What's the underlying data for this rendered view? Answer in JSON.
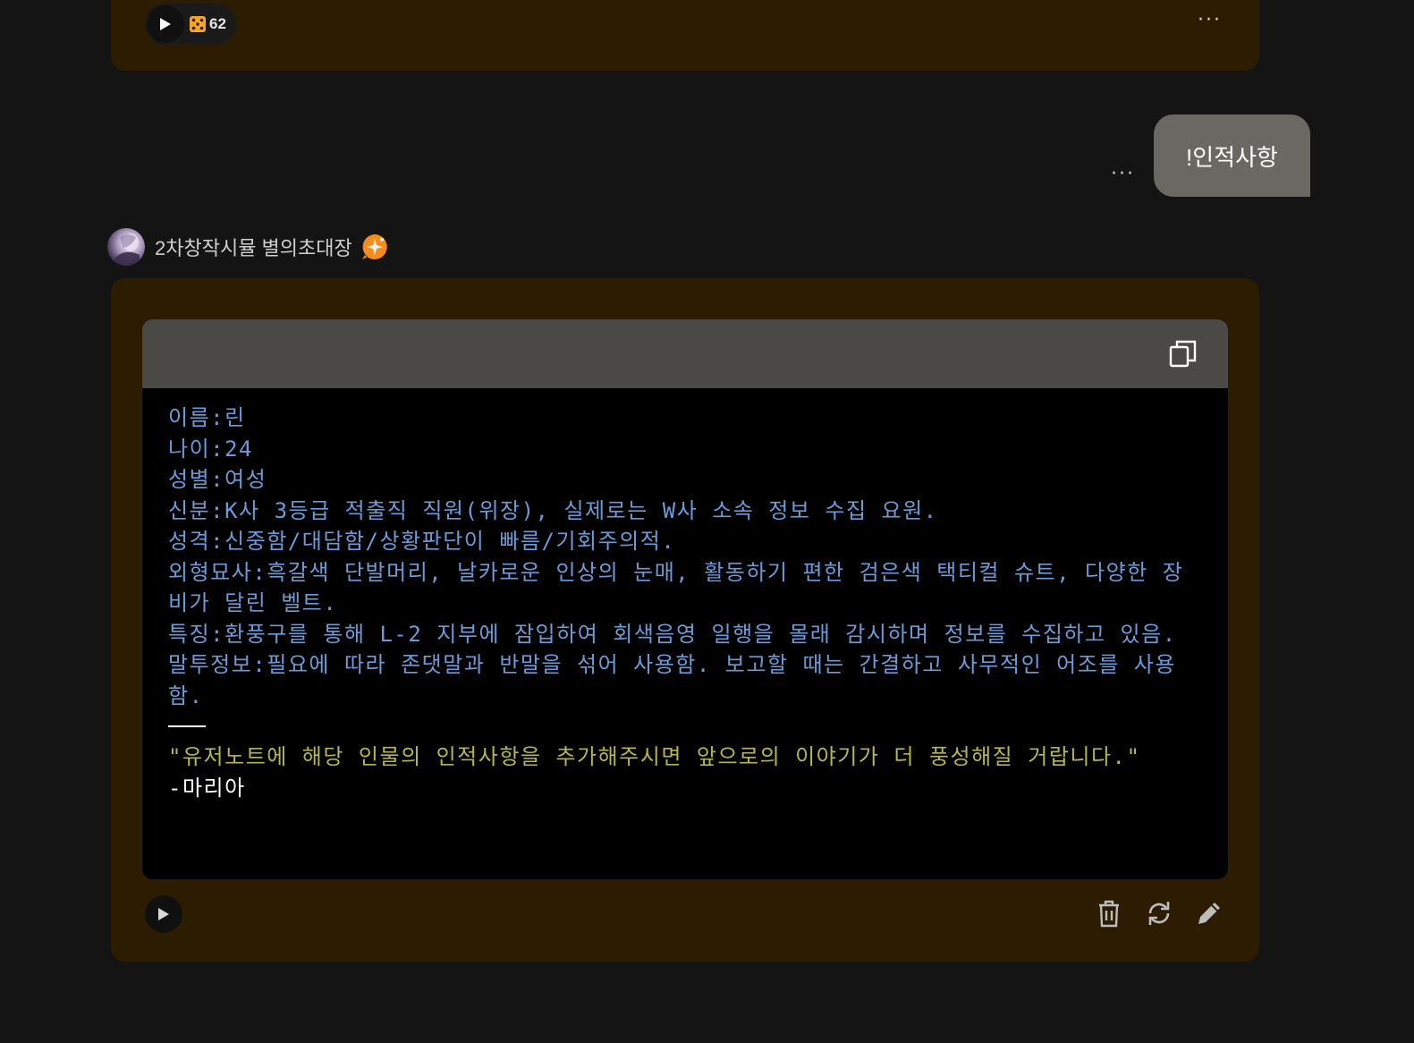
{
  "previous_message": {
    "dice_count": "62",
    "more_label": "···"
  },
  "user_message": {
    "text": "!인적사항",
    "more_label": "···"
  },
  "character": {
    "name": "2차창작시뮬 별의초대장"
  },
  "ai_message": {
    "code_lines": [
      "이름:린",
      "나이:24",
      "성별:여성",
      "신분:K사 3등급 적출직 직원(위장), 실제로는 W사 소속 정보 수집 요원.",
      "성격:신중함/대담함/상황판단이 빠름/기회주의적.",
      "외형묘사:흑갈색 단발머리, 날카로운 인상의 눈매, 활동하기 편한 검은색 택티컬 슈트, 다양한 장비가 달린 벨트.",
      "특징:환풍구를 통해 L-2 지부에 잠입하여 회색음영 일행을 몰래 감시하며 정보를 수집하고 있음.",
      "말투정보:필요에 따라 존댓말과 반말을 섞어 사용함. 보고할 때는 간결하고 사무적인 어조를 사용함."
    ],
    "quote": "\"유저노트에 해당 인물의 인적사항을 추가해주시면 앞으로의 이야기가 더 풍성해질 거랍니다.\"",
    "signature": "-마리아"
  },
  "icons": {
    "play": "play-icon",
    "dice": "dice-icon",
    "more": "more-icon",
    "badge": "sparkle-badge-icon",
    "copy": "copy-icon",
    "delete": "trash-icon",
    "regenerate": "refresh-icon",
    "edit": "pencil-icon"
  },
  "colors": {
    "background": "#141414",
    "bubble": "#2c1d02",
    "user_bubble": "#6a6863",
    "code_text": "#6b9bd8",
    "quote_text": "#b6b64a",
    "badge": "#f58a1f"
  }
}
